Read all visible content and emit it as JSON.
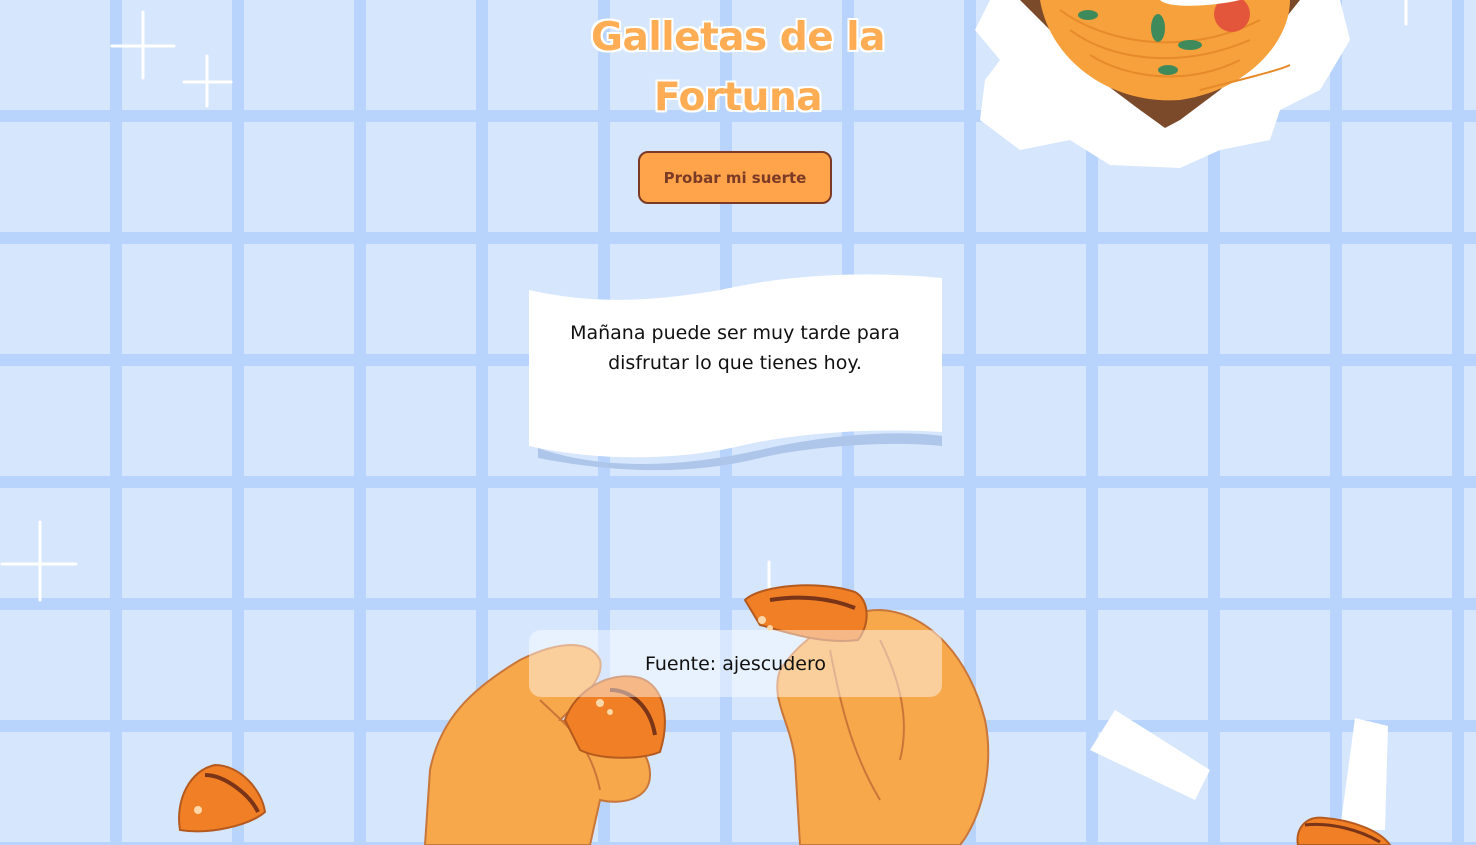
{
  "header": {
    "title_line1": "Galletas de la",
    "title_line2": "Fortuna"
  },
  "actions": {
    "try_luck_label": "Probar mi suerte"
  },
  "fortune": {
    "message": "Mañana puede ser muy tarde para disfrutar lo que tienes hoy."
  },
  "source": {
    "text": "Fuente: ajescudero"
  },
  "colors": {
    "background": "#d6e6fd",
    "grid": "#b9d4fc",
    "accent": "#ffa44b",
    "button_border": "#7b3a26",
    "title": "#ffad55"
  }
}
